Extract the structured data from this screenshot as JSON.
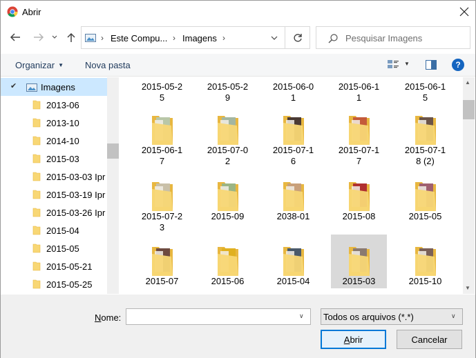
{
  "window": {
    "title": "Abrir"
  },
  "address": {
    "crumbs": [
      "Este Compu...",
      "Imagens"
    ]
  },
  "search": {
    "placeholder": "Pesquisar Imagens"
  },
  "toolbar": {
    "organize_label": "Organizar",
    "new_folder_label": "Nova pasta",
    "help_label": "?"
  },
  "colors": {
    "folder": "#f8d775",
    "folder_dark": "#e8b740",
    "selected_nav": "#cce8ff",
    "selected_tile": "#d9d9d9",
    "accent": "#0078d7"
  },
  "nav_pane": {
    "root": {
      "label": "Imagens",
      "icon": "pictures-icon"
    },
    "items": [
      "2013-06",
      "2013-10",
      "2014-10",
      "2015-03",
      "2015-03-03 Ipr",
      "2015-03-19 Ipr",
      "2015-03-26 Ipr",
      "2015-04",
      "2015-05",
      "2015-05-21",
      "2015-05-25"
    ]
  },
  "content": {
    "partial_row": [
      [
        "2015-05-2",
        "5"
      ],
      [
        "2015-05-2",
        "9"
      ],
      [
        "2015-06-0",
        "1"
      ],
      [
        "2015-06-1",
        "1"
      ],
      [
        "2015-06-1",
        "5"
      ]
    ],
    "rows": [
      [
        {
          "line1": "2015-06-1",
          "line2": "7"
        },
        {
          "line1": "2015-07-0",
          "line2": "2"
        },
        {
          "line1": "2015-07-1",
          "line2": "6"
        },
        {
          "line1": "2015-07-1",
          "line2": "7"
        },
        {
          "line1": "2015-07-1",
          "line2": "8 (2)"
        }
      ],
      [
        {
          "line1": "2015-07-2",
          "line2": "3"
        },
        {
          "line1": "2015-09",
          "line2": ""
        },
        {
          "line1": "2038-01",
          "line2": ""
        },
        {
          "line1": "2015-08",
          "line2": ""
        },
        {
          "line1": "2015-05",
          "line2": ""
        }
      ],
      [
        {
          "line1": "2015-07",
          "line2": ""
        },
        {
          "line1": "2015-06",
          "line2": ""
        },
        {
          "line1": "2015-04",
          "line2": ""
        },
        {
          "line1": "2015-03",
          "line2": "",
          "selected": true
        },
        {
          "line1": "2015-10",
          "line2": ""
        }
      ]
    ]
  },
  "bottom": {
    "name_label_first": "N",
    "name_label_rest": "ome:",
    "name_value": "",
    "filter_label": "Todos os arquivos (*.*)",
    "open_first": "A",
    "open_rest": "brir",
    "cancel_label": "Cancelar"
  }
}
